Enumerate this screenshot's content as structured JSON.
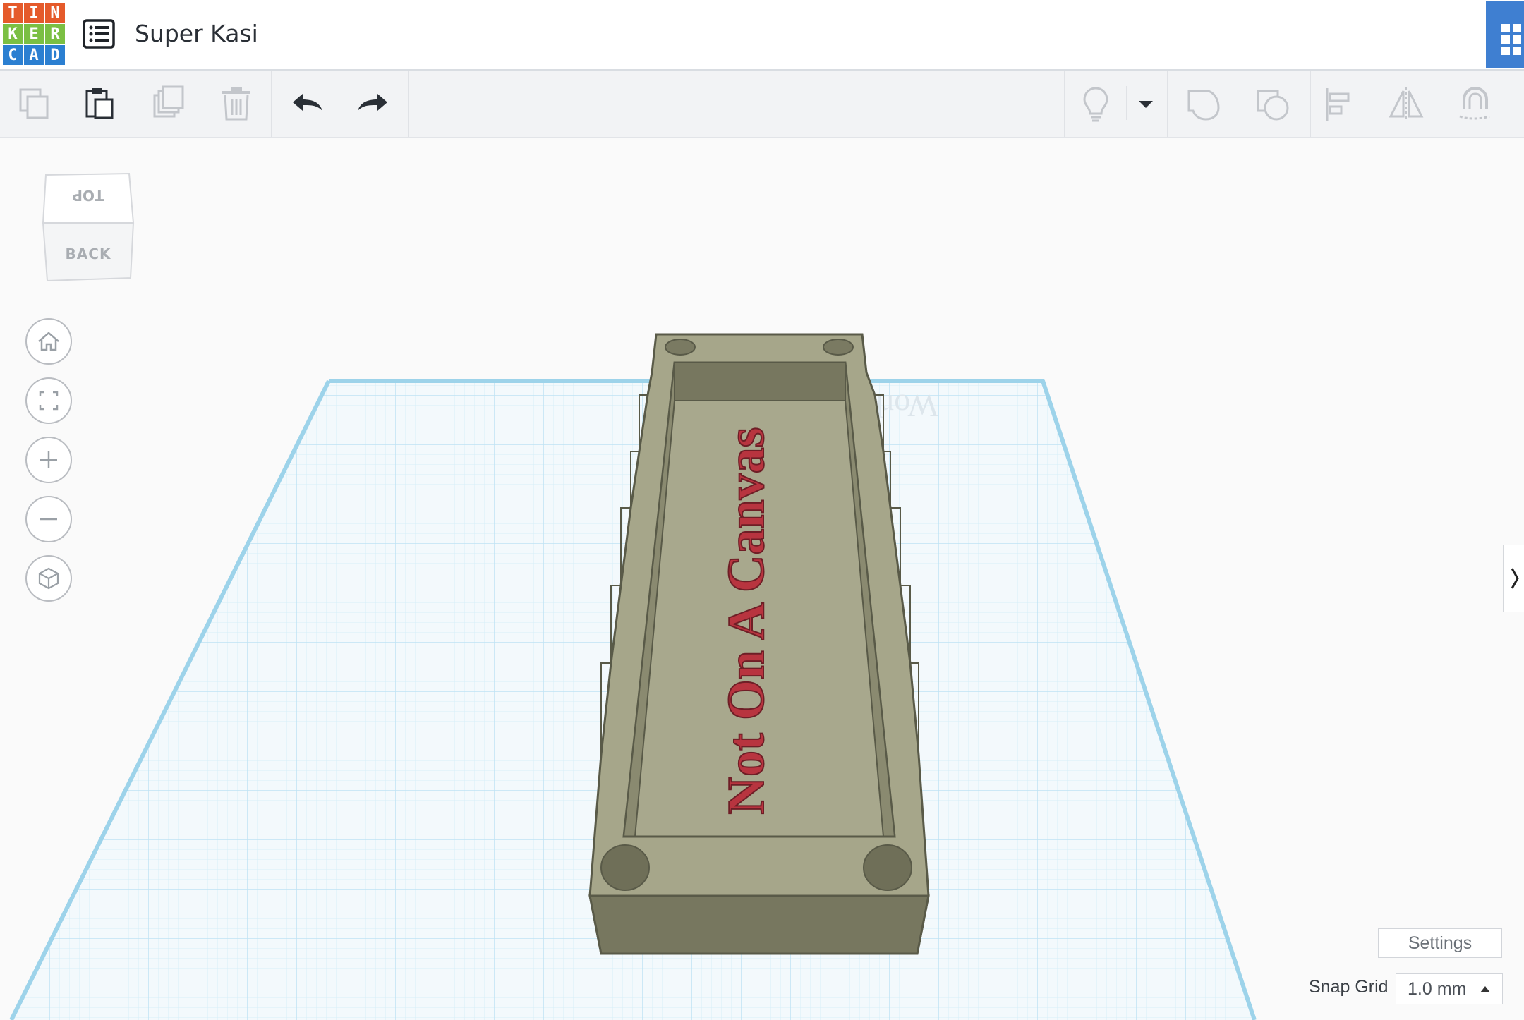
{
  "app": {
    "logo_letters": [
      "T",
      "I",
      "N",
      "K",
      "E",
      "R",
      "C",
      "A",
      "D"
    ],
    "logo_colors": [
      "#e55a2b",
      "#e55a2b",
      "#e55a2b",
      "#7bbf43",
      "#7bbf43",
      "#7bbf43",
      "#2b7fd1",
      "#2b7fd1",
      "#2b7fd1"
    ],
    "design_title": "Super Kasi"
  },
  "toolbar": {
    "copy_icon": "copy-icon",
    "paste_icon": "paste-icon",
    "duplicate_icon": "duplicate-icon",
    "delete_icon": "trash-icon",
    "undo_icon": "undo-icon",
    "redo_icon": "redo-icon",
    "notes_icon": "lightbulb-icon",
    "group_icon": "group-icon",
    "ungroup_icon": "ungroup-icon",
    "align_icon": "align-icon",
    "mirror_icon": "mirror-icon",
    "magnet_icon": "magnet-icon"
  },
  "viewcube": {
    "top": "TOP",
    "back": "BACK"
  },
  "nav": [
    "home-icon",
    "fit-icon",
    "zoom-in-icon",
    "zoom-out-icon",
    "perspective-icon"
  ],
  "workplane": {
    "label": "Workplane",
    "model_text": "Not On A Canvas",
    "text_color": "#b8343f",
    "body_color": "#a6a68a",
    "grid_color": "#bfe3f3"
  },
  "footer": {
    "settings_label": "Settings",
    "snap_label": "Snap Grid",
    "snap_value": "1.0 mm"
  }
}
